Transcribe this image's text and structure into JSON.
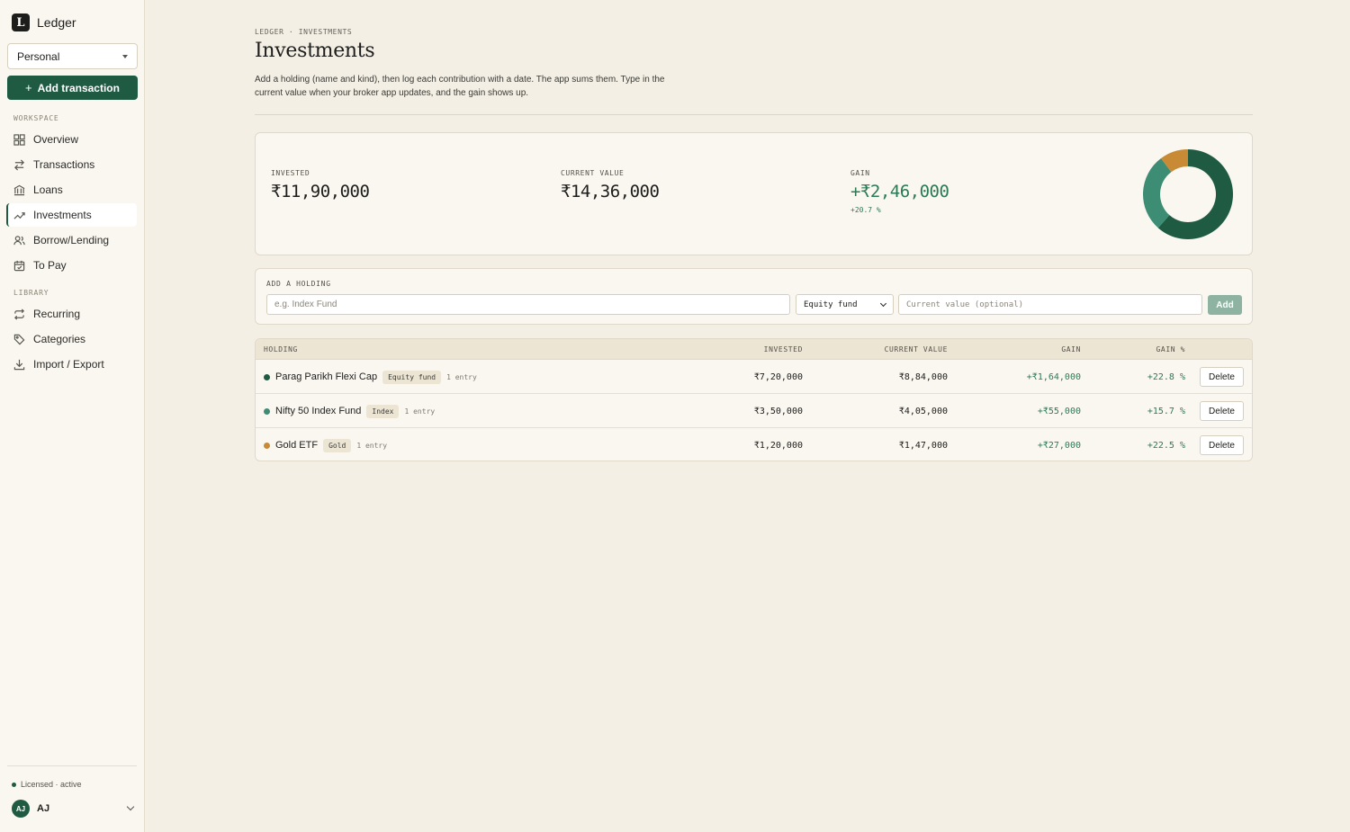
{
  "sidebar": {
    "brand_letter": "L",
    "brand_name": "Ledger",
    "workspace": "Personal",
    "add_transaction": "Add transaction",
    "workspace_section": "WORKSPACE",
    "library_section": "LIBRARY",
    "nav": [
      {
        "label": "Overview",
        "icon": "grid-icon"
      },
      {
        "label": "Transactions",
        "icon": "arrows-icon"
      },
      {
        "label": "Loans",
        "icon": "bank-icon"
      },
      {
        "label": "Investments",
        "icon": "trend-up-icon",
        "active": true
      },
      {
        "label": "Borrow/Lending",
        "icon": "users-icon"
      },
      {
        "label": "To Pay",
        "icon": "calendar-icon"
      }
    ],
    "library": [
      {
        "label": "Recurring",
        "icon": "repeat-icon"
      },
      {
        "label": "Categories",
        "icon": "tag-icon"
      },
      {
        "label": "Import / Export",
        "icon": "download-icon"
      }
    ],
    "license": "Licensed · active",
    "user_initials": "AJ",
    "user_name": "AJ"
  },
  "header": {
    "breadcrumb": "LEDGER · INVESTMENTS",
    "title": "Investments",
    "description": "Add a holding (name and kind), then log each contribution with a date. The app sums them. Type in the current value when your broker app updates, and the gain shows up."
  },
  "summary": {
    "invested_label": "INVESTED",
    "invested_value": "₹11,90,000",
    "current_label": "CURRENT VALUE",
    "current_value": "₹14,36,000",
    "gain_label": "GAIN",
    "gain_value": "+₹2,46,000",
    "gain_pct": "+20.7 %"
  },
  "chart_data": {
    "type": "pie",
    "categories": [
      "Parag Parikh Flexi Cap",
      "Nifty 50 Index Fund",
      "Gold ETF"
    ],
    "values": [
      884000,
      405000,
      147000
    ],
    "colors": [
      "#1f5a43",
      "#3d8c74",
      "#c88a34"
    ]
  },
  "add_holding": {
    "label": "ADD A HOLDING",
    "name_placeholder": "e.g. Index Fund",
    "kind_selected": "Equity fund",
    "value_placeholder": "Current value (optional)",
    "add_label": "Add"
  },
  "table": {
    "headers": {
      "holding": "HOLDING",
      "invested": "INVESTED",
      "current": "CURRENT VALUE",
      "gain": "GAIN",
      "gain_pct": "GAIN %"
    },
    "delete_label": "Delete",
    "rows": [
      {
        "name": "Parag Parikh Flexi Cap",
        "kind": "Equity fund",
        "entries": "1 entry",
        "invested": "₹7,20,000",
        "current": "₹8,84,000",
        "gain": "+₹1,64,000",
        "gain_pct": "+22.8 %",
        "color": "#1f5a43"
      },
      {
        "name": "Nifty 50 Index Fund",
        "kind": "Index",
        "entries": "1 entry",
        "invested": "₹3,50,000",
        "current": "₹4,05,000",
        "gain": "+₹55,000",
        "gain_pct": "+15.7 %",
        "color": "#3d8c74"
      },
      {
        "name": "Gold ETF",
        "kind": "Gold",
        "entries": "1 entry",
        "invested": "₹1,20,000",
        "current": "₹1,47,000",
        "gain": "+₹27,000",
        "gain_pct": "+22.5 %",
        "color": "#c88a34"
      }
    ]
  }
}
